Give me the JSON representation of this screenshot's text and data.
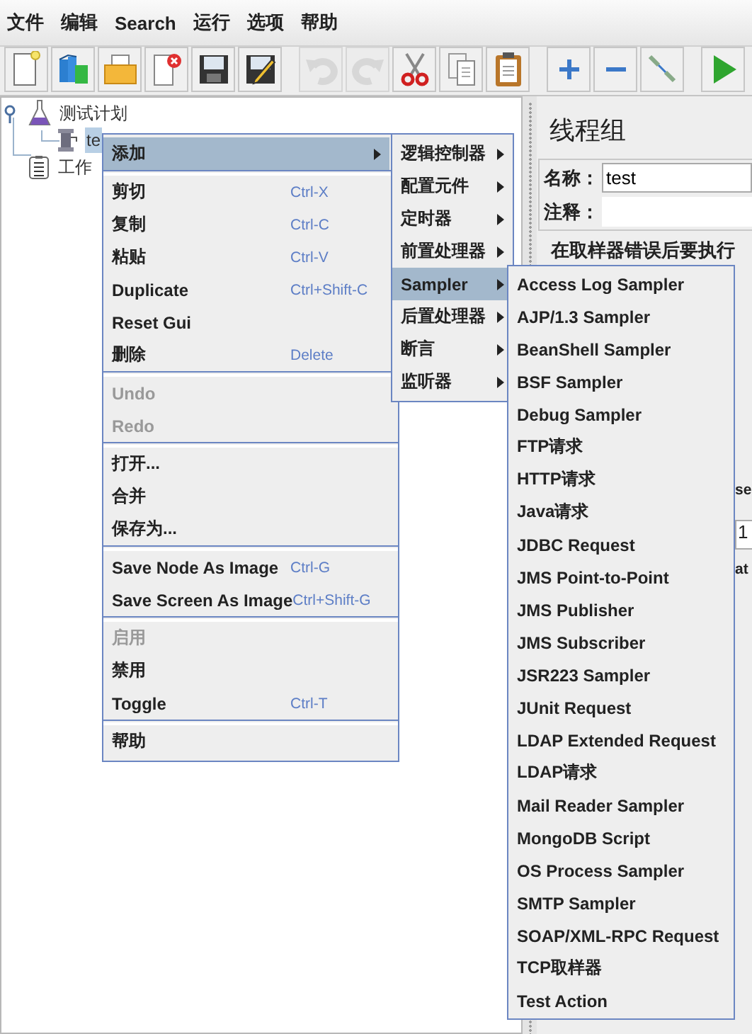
{
  "menu_bar": [
    {
      "label": "文件"
    },
    {
      "label": "编辑"
    },
    {
      "label": "Search"
    },
    {
      "label": "运行"
    },
    {
      "label": "选项"
    },
    {
      "label": "帮助"
    }
  ],
  "toolbar": {
    "groups": [
      [
        {
          "kind": "new",
          "disabled": false
        },
        {
          "kind": "templates",
          "disabled": false
        },
        {
          "kind": "open",
          "disabled": false
        },
        {
          "kind": "close",
          "disabled": false
        },
        {
          "kind": "save",
          "disabled": false
        },
        {
          "kind": "save_as",
          "disabled": false
        }
      ],
      [
        {
          "kind": "undo",
          "disabled": true
        },
        {
          "kind": "redo",
          "disabled": true
        },
        {
          "kind": "cut",
          "disabled": false
        },
        {
          "kind": "copy",
          "disabled": false
        },
        {
          "kind": "paste",
          "disabled": false
        }
      ],
      [
        {
          "kind": "expand",
          "disabled": false
        },
        {
          "kind": "collapse",
          "disabled": false
        },
        {
          "kind": "toggle",
          "disabled": false
        }
      ],
      [
        {
          "kind": "start",
          "disabled": false
        }
      ]
    ]
  },
  "tree": [
    {
      "label": "测试计划",
      "kind": "plan",
      "selected": false,
      "expanded": true,
      "children": [
        {
          "label": "te",
          "kind": "thread_group",
          "selected": true
        }
      ]
    },
    {
      "label": "工作",
      "kind": "workbench",
      "selected": false
    }
  ],
  "right_panel": {
    "title": "线程组",
    "fields": [
      {
        "label": "名称：",
        "value": "test"
      },
      {
        "label": "注释："
      }
    ],
    "group_title": "在取样器错误后要执行",
    "partial_texts": [
      {
        "text": "se",
        "kind": "label"
      },
      {
        "text": "1",
        "kind": "field"
      },
      {
        "text": "at",
        "kind": "label"
      }
    ]
  },
  "context_menu": {
    "groups": [
      [
        {
          "label": "添加",
          "kind": "submenu",
          "selected": true,
          "disabled": false
        }
      ],
      [
        {
          "label": "剪切",
          "shortcut": "Ctrl-X",
          "kind": "command",
          "selected": false,
          "disabled": false
        },
        {
          "label": "复制",
          "shortcut": "Ctrl-C",
          "kind": "command",
          "selected": false,
          "disabled": false
        },
        {
          "label": "粘贴",
          "shortcut": "Ctrl-V",
          "kind": "command",
          "selected": false,
          "disabled": false
        },
        {
          "label": "Duplicate",
          "shortcut": "Ctrl+Shift-C",
          "kind": "command",
          "selected": false,
          "disabled": false
        },
        {
          "label": "Reset Gui",
          "kind": "command",
          "selected": false,
          "disabled": false
        },
        {
          "label": "删除",
          "shortcut": "Delete",
          "kind": "command",
          "selected": false,
          "disabled": false
        }
      ],
      [
        {
          "label": "Undo",
          "kind": "command",
          "selected": false,
          "disabled": true
        },
        {
          "label": "Redo",
          "kind": "command",
          "selected": false,
          "disabled": true
        }
      ],
      [
        {
          "label": "打开...",
          "kind": "command",
          "selected": false,
          "disabled": false
        },
        {
          "label": "合并",
          "kind": "command",
          "selected": false,
          "disabled": false
        },
        {
          "label": "保存为...",
          "kind": "command",
          "selected": false,
          "disabled": false
        }
      ],
      [
        {
          "label": "Save Node As Image",
          "shortcut": "Ctrl-G",
          "kind": "command",
          "selected": false,
          "disabled": false
        },
        {
          "label": "Save Screen As Image",
          "shortcut": "Ctrl+Shift-G",
          "kind": "command",
          "selected": false,
          "disabled": false
        }
      ],
      [
        {
          "label": "启用",
          "kind": "command",
          "selected": false,
          "disabled": true
        },
        {
          "label": "禁用",
          "kind": "command",
          "selected": false,
          "disabled": false
        },
        {
          "label": "Toggle",
          "shortcut": "Ctrl-T",
          "kind": "command",
          "selected": false,
          "disabled": false
        }
      ],
      [
        {
          "label": "帮助",
          "kind": "command",
          "selected": false,
          "disabled": false
        }
      ]
    ]
  },
  "add_submenu": {
    "groups": [
      [
        {
          "label": "逻辑控制器",
          "kind": "submenu",
          "selected": false
        },
        {
          "label": "配置元件",
          "kind": "submenu",
          "selected": false
        },
        {
          "label": "定时器",
          "kind": "submenu",
          "selected": false
        },
        {
          "label": "前置处理器",
          "kind": "submenu",
          "selected": false
        },
        {
          "label": "Sampler",
          "kind": "submenu",
          "selected": true
        },
        {
          "label": "后置处理器",
          "kind": "submenu",
          "selected": false
        },
        {
          "label": "断言",
          "kind": "submenu",
          "selected": false
        },
        {
          "label": "监听器",
          "kind": "submenu",
          "selected": false
        }
      ]
    ]
  },
  "sampler_submenu": {
    "groups": [
      [
        {
          "label": "Access Log Sampler",
          "kind": "command",
          "selected": false
        },
        {
          "label": "AJP/1.3 Sampler",
          "kind": "command",
          "selected": false
        },
        {
          "label": "BeanShell Sampler",
          "kind": "command",
          "selected": false
        },
        {
          "label": "BSF Sampler",
          "kind": "command",
          "selected": false
        },
        {
          "label": "Debug Sampler",
          "kind": "command",
          "selected": false
        },
        {
          "label": "FTP请求",
          "kind": "command",
          "selected": false
        },
        {
          "label": "HTTP请求",
          "kind": "command",
          "selected": false
        },
        {
          "label": "Java请求",
          "kind": "command",
          "selected": false
        },
        {
          "label": "JDBC Request",
          "kind": "command",
          "selected": false
        },
        {
          "label": "JMS Point-to-Point",
          "kind": "command",
          "selected": false
        },
        {
          "label": "JMS Publisher",
          "kind": "command",
          "selected": false
        },
        {
          "label": "JMS Subscriber",
          "kind": "command",
          "selected": false
        },
        {
          "label": "JSR223 Sampler",
          "kind": "command",
          "selected": false
        },
        {
          "label": "JUnit Request",
          "kind": "command",
          "selected": false
        },
        {
          "label": "LDAP Extended Request",
          "kind": "command",
          "selected": false
        },
        {
          "label": "LDAP请求",
          "kind": "command",
          "selected": false
        },
        {
          "label": "Mail Reader Sampler",
          "kind": "command",
          "selected": false
        },
        {
          "label": "MongoDB Script",
          "kind": "command",
          "selected": false
        },
        {
          "label": "OS Process Sampler",
          "kind": "command",
          "selected": false
        },
        {
          "label": "SMTP Sampler",
          "kind": "command",
          "selected": false
        },
        {
          "label": "SOAP/XML-RPC Request",
          "kind": "command",
          "selected": false
        },
        {
          "label": "TCP取样器",
          "kind": "command",
          "selected": false
        },
        {
          "label": "Test Action",
          "kind": "command",
          "selected": false
        }
      ]
    ]
  }
}
